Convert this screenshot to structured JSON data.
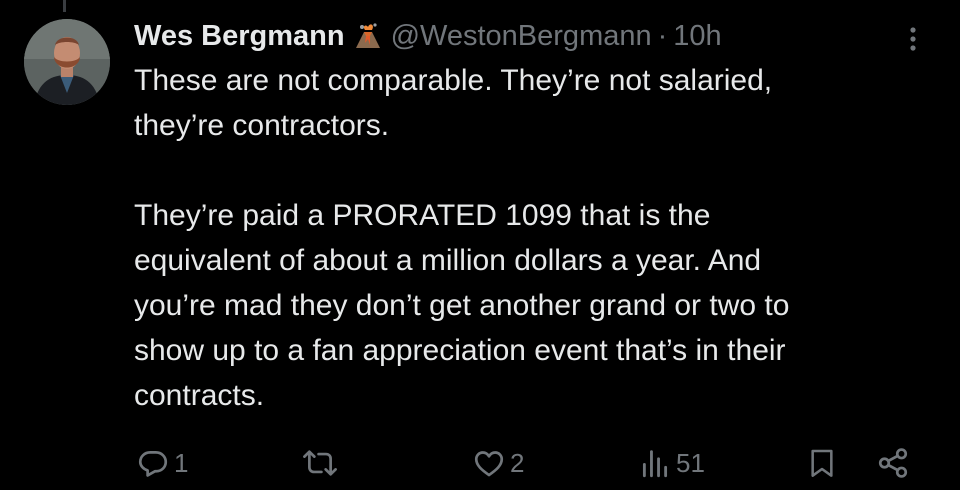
{
  "tweet": {
    "display_name": "Wes Bergmann",
    "badge_emoji": "volcano-emoji",
    "handle": "@WestonBergmann",
    "separator": "·",
    "time": "10h",
    "paragraphs": [
      [
        "These are not comparable. They’re not salaried,",
        "they’re contractors."
      ],
      [
        "They’re paid a PRORATED 1099 that is the",
        "equivalent of about a million dollars a year. And",
        "you’re mad they don’t get another grand or two to",
        "show up to a fan appreciation event that’s in their",
        "contracts."
      ]
    ]
  },
  "actions": {
    "reply_count": "1",
    "retweet_count": "",
    "like_count": "2",
    "views_count": "51"
  },
  "colors": {
    "background": "#000000",
    "text": "#e7e9ea",
    "muted": "#71767b"
  }
}
